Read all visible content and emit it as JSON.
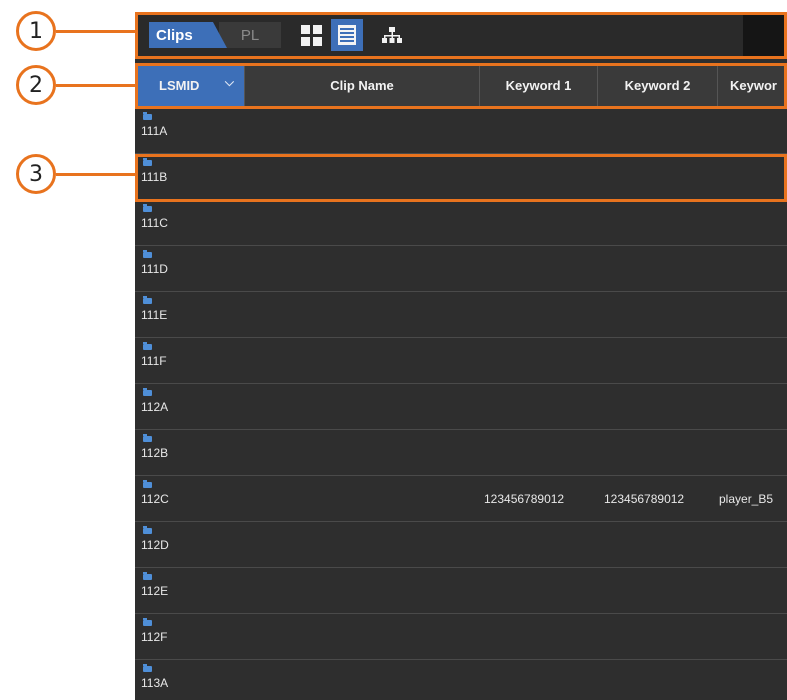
{
  "callouts": [
    "1",
    "2",
    "3"
  ],
  "toolbar": {
    "clips_tab": "Clips",
    "pl_tab": "PL",
    "grid_view_icon": "grid-view-icon",
    "list_view_icon": "list-view-icon",
    "tree_view_icon": "hierarchy-icon"
  },
  "columns": [
    "LSMID",
    "Clip Name",
    "Keyword 1",
    "Keyword 2",
    "Keywor"
  ],
  "rows": [
    {
      "id": "111A",
      "keyword1": "",
      "keyword2": "",
      "keyword3": ""
    },
    {
      "id": "111B",
      "keyword1": "",
      "keyword2": "",
      "keyword3": ""
    },
    {
      "id": "111C",
      "keyword1": "",
      "keyword2": "",
      "keyword3": ""
    },
    {
      "id": "111D",
      "keyword1": "",
      "keyword2": "",
      "keyword3": ""
    },
    {
      "id": "111E",
      "keyword1": "",
      "keyword2": "",
      "keyword3": ""
    },
    {
      "id": "111F",
      "keyword1": "",
      "keyword2": "",
      "keyword3": ""
    },
    {
      "id": "112A",
      "keyword1": "",
      "keyword2": "",
      "keyword3": ""
    },
    {
      "id": "112B",
      "keyword1": "",
      "keyword2": "",
      "keyword3": ""
    },
    {
      "id": "112C",
      "keyword1": "123456789012",
      "keyword2": "123456789012",
      "keyword3": "player_B5"
    },
    {
      "id": "112D",
      "keyword1": "",
      "keyword2": "",
      "keyword3": ""
    },
    {
      "id": "112E",
      "keyword1": "",
      "keyword2": "",
      "keyword3": ""
    },
    {
      "id": "112F",
      "keyword1": "",
      "keyword2": "",
      "keyword3": ""
    },
    {
      "id": "113A",
      "keyword1": "",
      "keyword2": "",
      "keyword3": ""
    }
  ],
  "colors": {
    "accent": "#3d6fb8",
    "callout": "#e8731e",
    "panel": "#2e2e2e"
  }
}
